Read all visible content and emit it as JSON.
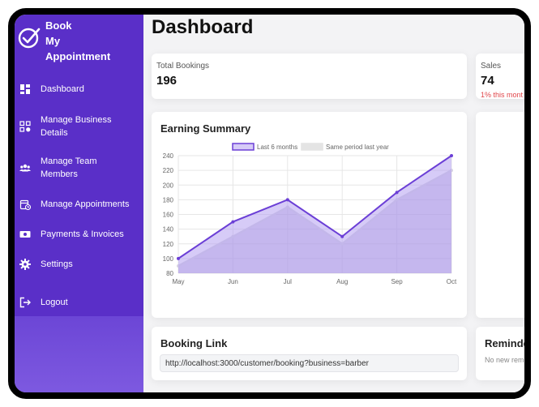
{
  "brand": {
    "line1": "Book",
    "line2": "My",
    "line3": "Appointment"
  },
  "sidebar": {
    "items": [
      {
        "label": "Dashboard",
        "icon": "dashboard-icon"
      },
      {
        "label": "Manage Business Details",
        "icon": "business-icon"
      },
      {
        "label": "Manage Team Members",
        "icon": "team-icon"
      },
      {
        "label": "Manage Appointments",
        "icon": "calendar-icon"
      },
      {
        "label": "Payments & Invoices",
        "icon": "payment-icon"
      },
      {
        "label": "Settings",
        "icon": "gear-icon"
      },
      {
        "label": "Logout",
        "icon": "logout-icon"
      }
    ]
  },
  "header": {
    "title": "Dashboard"
  },
  "stats": {
    "bookings": {
      "label": "Total Bookings",
      "value": "196"
    },
    "sales": {
      "label": "Sales",
      "value": "74",
      "note": "1% this mont"
    }
  },
  "earning": {
    "title": "Earning Summary"
  },
  "booking_link": {
    "title": "Booking Link",
    "url": "http://localhost:3000/customer/booking?business=barber"
  },
  "reminders": {
    "title": "Reminde",
    "empty": "No new rem"
  },
  "colors": {
    "sidebar": "#5a2fc8",
    "accent": "#6b3fd6",
    "series2": "#d9d9d9",
    "negative": "#e0454a"
  },
  "chart_data": {
    "type": "line",
    "categories": [
      "May",
      "Jun",
      "Jul",
      "Aug",
      "Sep",
      "Oct"
    ],
    "series": [
      {
        "name": "Last 6 months",
        "values": [
          100,
          150,
          180,
          130,
          190,
          240
        ]
      },
      {
        "name": "Same period last year",
        "values": [
          90,
          130,
          170,
          120,
          180,
          220
        ]
      }
    ],
    "yticks": [
      80,
      100,
      120,
      140,
      160,
      180,
      200,
      220,
      240
    ],
    "ylim": [
      80,
      240
    ],
    "grid": true,
    "legend": "top"
  }
}
